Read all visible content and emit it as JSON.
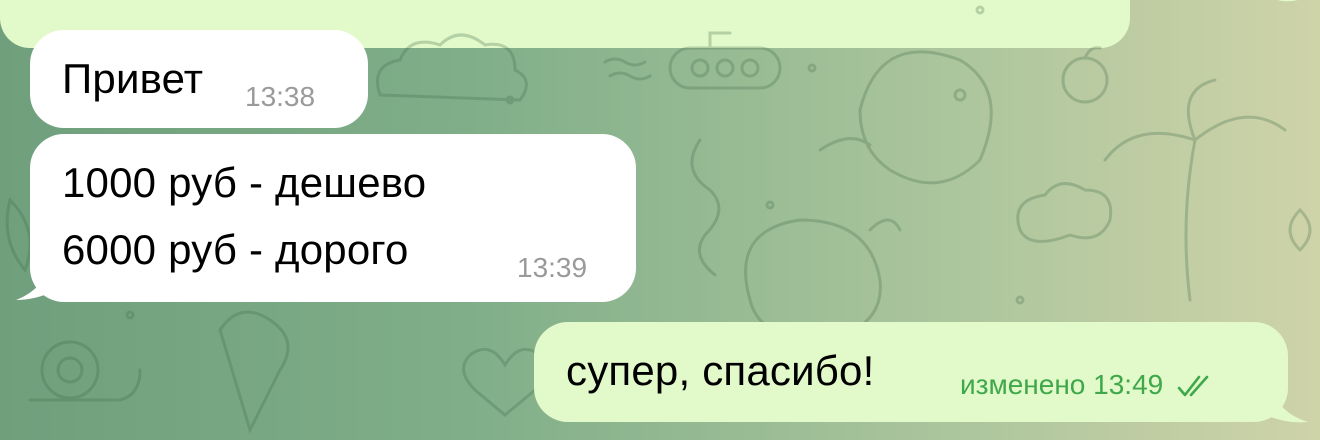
{
  "chat": {
    "messages": [
      {
        "direction": "incoming",
        "lines": [
          "Привет"
        ],
        "time": "13:38"
      },
      {
        "direction": "incoming",
        "lines": [
          "1000 руб - дешево",
          "6000 руб - дорого"
        ],
        "time": "13:39"
      },
      {
        "direction": "outgoing",
        "lines": [
          "супер, спасибо!"
        ],
        "edited_label": "изменено",
        "time": "13:49",
        "status_icon": "double-check-icon"
      }
    ]
  },
  "colors": {
    "incoming_bubble": "#ffffff",
    "outgoing_bubble": "#e2f9c9",
    "incoming_meta": "#9a9a9a",
    "outgoing_meta": "#3ea84a"
  },
  "background_icons": [
    "cloud-icon",
    "submarine-icon",
    "whale-icon",
    "palm-tree-icon",
    "snail-icon",
    "ice-cream-icon",
    "heart-icon",
    "fruit-icon"
  ]
}
